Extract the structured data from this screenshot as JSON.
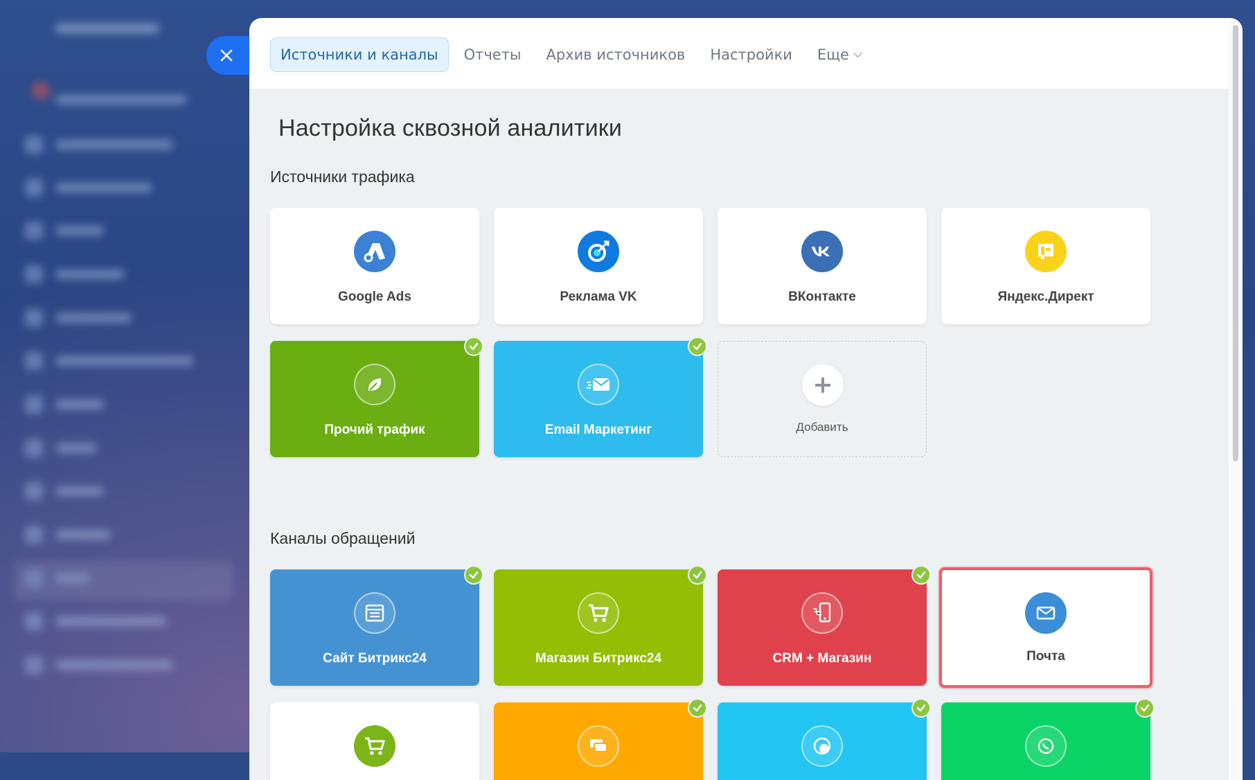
{
  "tabs": [
    {
      "label": "Источники и каналы",
      "active": true
    },
    {
      "label": "Отчеты"
    },
    {
      "label": "Архив источников"
    },
    {
      "label": "Настройки"
    },
    {
      "label": "Еще"
    }
  ],
  "page_title": "Настройка сквозной аналитики",
  "traffic_sources": {
    "title": "Источники трафика",
    "cards": [
      {
        "label": "Google Ads",
        "icon": "google-ads-icon",
        "color": "#3b82d6"
      },
      {
        "label": "Реклама VK",
        "icon": "vk-ads-icon",
        "color": "#0f7be0"
      },
      {
        "label": "ВКонтакте",
        "icon": "vk-icon",
        "color": "#3b6fb6"
      },
      {
        "label": "Яндекс.Директ",
        "icon": "yandex-direct-icon",
        "color": "#fbd21a"
      },
      {
        "label": "Прочий трафик",
        "icon": "leaf-icon",
        "color": "#6aae12",
        "connected": true
      },
      {
        "label": "Email Маркетинг",
        "icon": "email-icon",
        "color": "#2ebcef",
        "connected": true
      },
      {
        "label": "Добавить",
        "icon": "plus-icon"
      }
    ]
  },
  "contact_channels": {
    "title": "Каналы обращений",
    "cards": [
      {
        "label": "Сайт Битрикс24",
        "icon": "website-icon",
        "color": "#4592d3",
        "connected": true
      },
      {
        "label": "Магазин Битрикс24",
        "icon": "cart-icon",
        "color": "#93be04",
        "connected": true
      },
      {
        "label": "CRM + Магазин",
        "icon": "phone-cart-icon",
        "color": "#e0424d",
        "connected": true
      },
      {
        "label": "Почта",
        "icon": "mail-icon",
        "color": "#3a8fd6",
        "selected": true
      },
      {
        "label": "",
        "icon": "cart-icon",
        "color": "#ffffff"
      },
      {
        "label": "",
        "icon": "chat-icon",
        "color": "#ffa800",
        "connected": true
      },
      {
        "label": "",
        "icon": "call-24-icon",
        "color": "#23c5f3",
        "connected": true
      },
      {
        "label": "",
        "icon": "whatsapp-icon",
        "color": "#0ad466",
        "connected": true
      }
    ]
  }
}
